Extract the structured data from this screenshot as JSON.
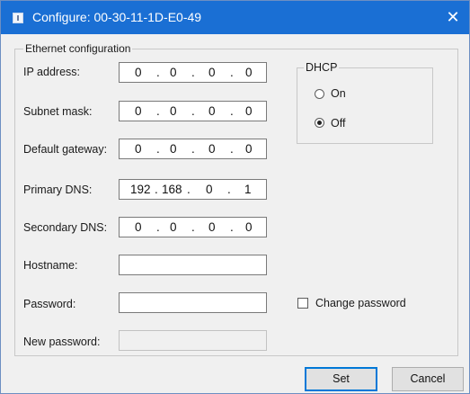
{
  "window": {
    "title": "Configure: 00-30-11-1D-E0-49",
    "close_symbol": "✕",
    "icon": "app-icon"
  },
  "ethernet": {
    "group_label": "Ethernet configuration",
    "ip_address": {
      "label": "IP address:",
      "octets": [
        "0",
        "0",
        "0",
        "0"
      ]
    },
    "subnet_mask": {
      "label": "Subnet mask:",
      "octets": [
        "0",
        "0",
        "0",
        "0"
      ]
    },
    "default_gateway": {
      "label": "Default gateway:",
      "octets": [
        "0",
        "0",
        "0",
        "0"
      ]
    },
    "primary_dns": {
      "label": "Primary DNS:",
      "octets": [
        "192",
        "168",
        "0",
        "1"
      ]
    },
    "secondary_dns": {
      "label": "Secondary DNS:",
      "octets": [
        "0",
        "0",
        "0",
        "0"
      ]
    },
    "hostname": {
      "label": "Hostname:",
      "value": ""
    },
    "password": {
      "label": "Password:",
      "value": ""
    },
    "new_password": {
      "label": "New password:",
      "value": "",
      "enabled": false
    }
  },
  "dhcp": {
    "group_label": "DHCP",
    "on_label": "On",
    "off_label": "Off",
    "selected": "Off"
  },
  "change_password": {
    "label": "Change password",
    "checked": false
  },
  "buttons": {
    "set": "Set",
    "cancel": "Cancel"
  },
  "dot": "."
}
